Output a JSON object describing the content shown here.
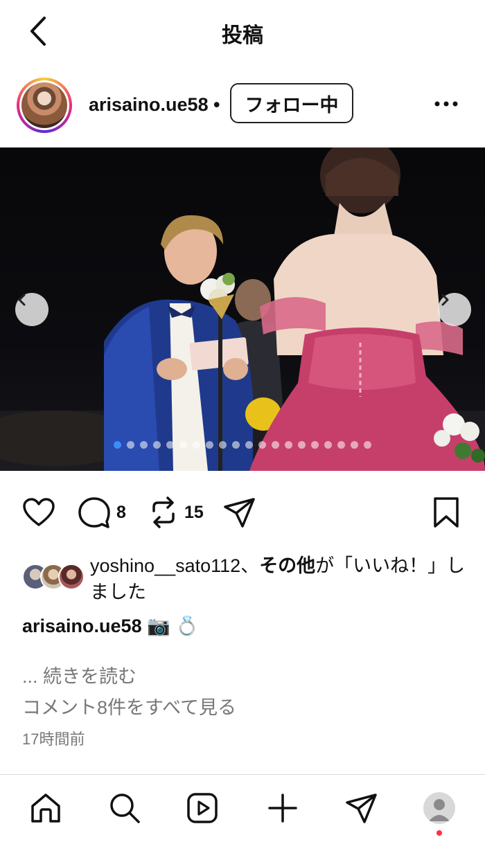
{
  "header": {
    "title": "投稿",
    "back_icon": "chevron-left-icon"
  },
  "post": {
    "username": "arisaino.ue58",
    "separator": "•",
    "follow_label": "フォロー中",
    "more_icon": "more-horizontal-icon",
    "carousel": {
      "total_slides": 20,
      "current_slide": 1
    },
    "actions": {
      "comment_count": "8",
      "repost_count": "15"
    },
    "likes": {
      "user": "yoshino__sato112",
      "separator": "、",
      "others": "その他",
      "suffix": "が「いいね！」しました"
    },
    "caption": {
      "username": "arisaino.ue58",
      "emojis": "📷 💍"
    },
    "read_more": "... 続きを読む",
    "view_comments": "コメント8件をすべて見る",
    "timestamp": "17時間前"
  },
  "colors": {
    "accent": "#3a8ef5",
    "muted": "#777777",
    "notification": "#ff3040"
  }
}
